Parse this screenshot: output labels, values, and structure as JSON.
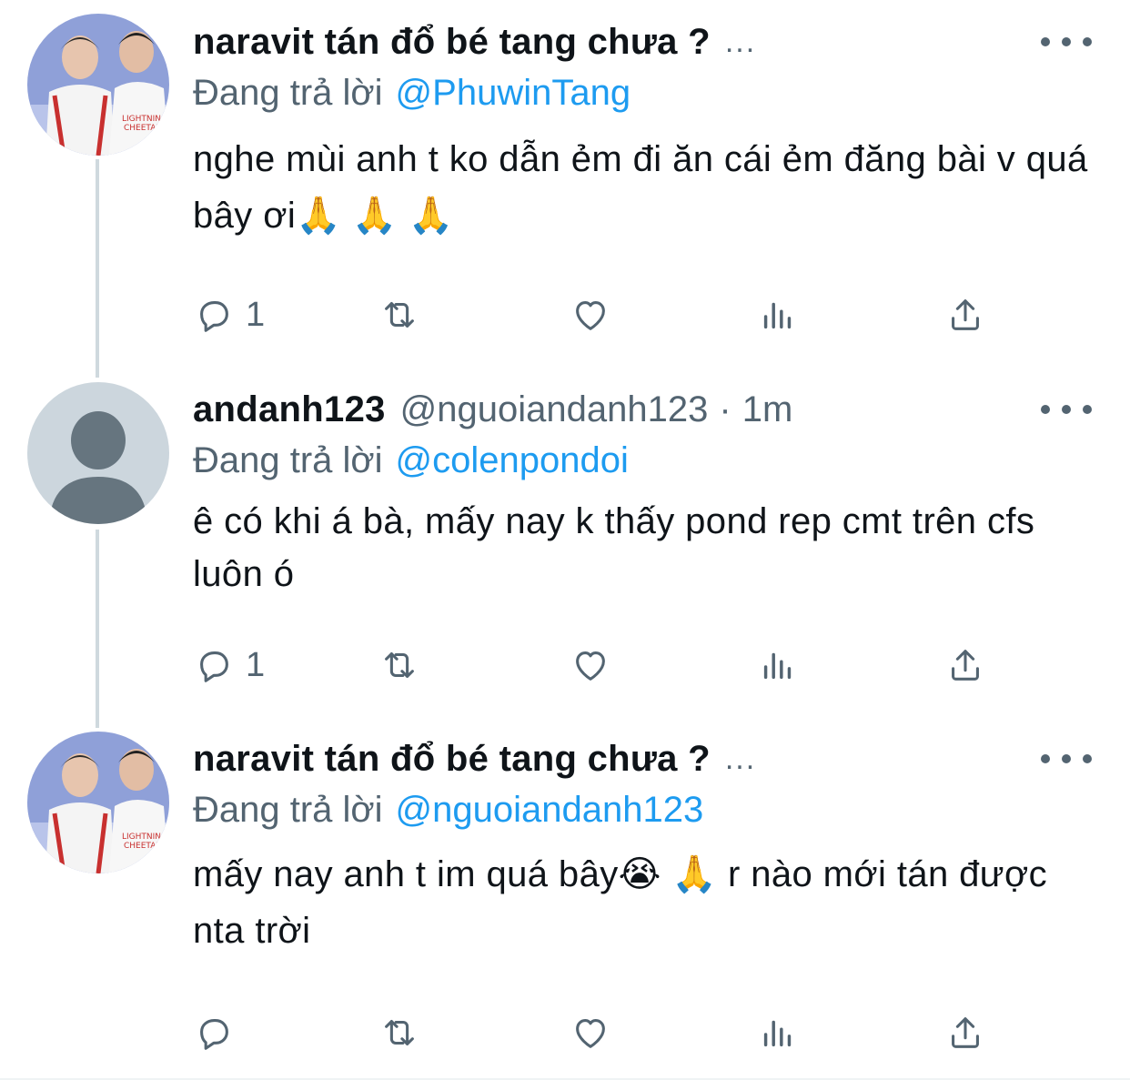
{
  "colors": {
    "accent": "#1d9bf0",
    "secondary_text": "#536471",
    "primary_text": "#0f1419",
    "thread_line": "#cfd9de"
  },
  "tweets": [
    {
      "author_name": "naravit tán đổ bé tang chưa ?",
      "name_truncation": "...",
      "reply_prefix": "Đang trả lời",
      "reply_handle": "@PhuwinTang",
      "text": "nghe mùi anh t ko dẫn ẻm đi ăn cái ẻm đăng bài v quá bây ơi🙏 🙏 🙏",
      "reply_count": "1",
      "avatar": "photo-avatar-icon"
    },
    {
      "author_name": "andanh123",
      "handle": "@nguoiandanh123",
      "separator": "·",
      "time": "1m",
      "reply_prefix": "Đang trả lời",
      "reply_handle": "@colenpondoi",
      "text": "ê có khi á bà, mấy nay k thấy pond rep cmt trên cfs luôn ó",
      "reply_count": "1",
      "avatar": "default-avatar-icon"
    },
    {
      "author_name": "naravit tán đổ bé tang chưa ?",
      "name_truncation": "...",
      "reply_prefix": "Đang trả lời",
      "reply_handle": "@nguoiandanh123",
      "text": "mấy nay anh t im quá bây😭 🙏  r nào mới tán được nta trời",
      "reply_count": "",
      "avatar": "photo-avatar-icon"
    }
  ]
}
